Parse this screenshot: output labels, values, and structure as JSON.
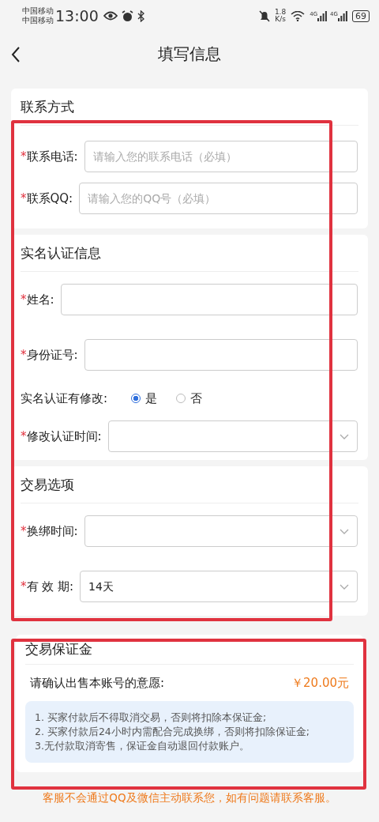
{
  "status_bar": {
    "carriers": [
      "中国移动",
      "中国移动"
    ],
    "time": "13:00",
    "net_speed": "1.8",
    "net_speed_unit": "K/s",
    "signals": [
      "4G",
      "4G"
    ],
    "battery": "69"
  },
  "header": {
    "title": "填写信息"
  },
  "sections": [
    {
      "title": "联系方式",
      "fields": [
        {
          "kind": "text",
          "label": "联系电话:",
          "marker": "*",
          "placeholder": "请输入您的联系电话（必填）"
        },
        {
          "kind": "text",
          "label": "联系QQ:",
          "marker": "*",
          "placeholder": "请输入您的QQ号（必填）"
        }
      ]
    },
    {
      "title": "实名认证信息",
      "fields": [
        {
          "kind": "text",
          "label": "姓名:",
          "marker": "*"
        },
        {
          "kind": "text",
          "label": "身份证号:",
          "marker": "*"
        },
        {
          "kind": "radio",
          "label": "实名认证有修改:",
          "options": [
            {
              "label": "是",
              "selected": true
            },
            {
              "label": "否",
              "selected": false
            }
          ]
        },
        {
          "kind": "select",
          "label": "修改认证时间:",
          "marker": "*"
        }
      ]
    },
    {
      "title": "交易选项",
      "fields": [
        {
          "kind": "select",
          "label": "换绑时间:",
          "marker": "*"
        },
        {
          "kind": "select",
          "label": "有 效 期:",
          "marker": "*",
          "value": "14天"
        }
      ]
    }
  ],
  "deposit": {
    "title": "交易保证金",
    "prompt": "请确认出售本账号的意愿:",
    "amount": "￥20.00元",
    "notes": [
      "1. 买家付款后不得取消交易，否则将扣除本保证金;",
      "2. 买家付款后24小时内需配合完成换绑，否则将扣除保证金;",
      "3.无付款取消寄售，保证金自动退回付款账户。"
    ]
  },
  "footer_notice": "客服不会通过QQ及微信主动联系您，如有问题请联系客服。"
}
